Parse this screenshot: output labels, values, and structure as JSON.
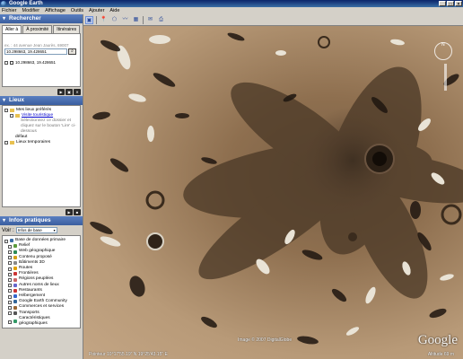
{
  "window": {
    "title": "Google Earth",
    "buttons": [
      "_",
      "□",
      "×"
    ]
  },
  "menu": [
    "Fichier",
    "Modifier",
    "Affichage",
    "Outils",
    "Ajouter",
    "Aide"
  ],
  "search": {
    "header": "Rechercher",
    "tabs": [
      "Aller à",
      "À proximité",
      "Itinéraires"
    ],
    "hint": "ex. : 44 avenue Jean Jaurès, 69007",
    "query": "10.298663, 19.428651",
    "button_icon": "magnifier-icon",
    "result": "10.298663, 19.428651"
  },
  "places": {
    "header": "Lieux",
    "items": [
      {
        "label": "Mes lieux préférés",
        "kind": "folder"
      },
      {
        "label": "Visite touristique",
        "kind": "link"
      },
      {
        "label": "Sélectionnez ce dossier et cliquez sur le bouton 'Lire' ci-dessous",
        "kind": "note"
      },
      {
        "label": "défaut",
        "kind": "plain"
      },
      {
        "label": "Lieux temporaires",
        "kind": "folder"
      }
    ]
  },
  "layers": {
    "header": "Infos pratiques",
    "view_label": "Voir :",
    "view_value": "Infos de base",
    "items": [
      {
        "label": "Base de données primaire",
        "color": "#3a6ea5"
      },
      {
        "label": "Relief",
        "color": "#5b9b3b"
      },
      {
        "label": "Web géographique",
        "color": "#2e8b57"
      },
      {
        "label": "Contenu proposé",
        "color": "#d4a017"
      },
      {
        "label": "Bâtiments 3D",
        "color": "#888888"
      },
      {
        "label": "Routes",
        "color": "#e0a000"
      },
      {
        "label": "Frontières",
        "color": "#cc3333"
      },
      {
        "label": "Régions peuplées",
        "color": "#cc6666"
      },
      {
        "label": "Autres noms de lieux",
        "color": "#6666cc"
      },
      {
        "label": "Restaurants",
        "color": "#cc3333"
      },
      {
        "label": "Hébergement",
        "color": "#3366cc"
      },
      {
        "label": "Google Earth Community",
        "color": "#336699"
      },
      {
        "label": "Commerces et services",
        "color": "#996633"
      },
      {
        "label": "Transports",
        "color": "#555555"
      },
      {
        "label": "Caractéristiques géographiques",
        "color": "#339966"
      }
    ]
  },
  "toolbar": {
    "icons": [
      "sidebar-toggle-icon",
      "placemark-icon",
      "polygon-icon",
      "path-icon",
      "overlay-icon",
      "email-icon",
      "print-icon"
    ],
    "glyphs": [
      "▣",
      "📍",
      "⬠",
      "〰",
      "▦",
      "✉",
      "⎙"
    ]
  },
  "map": {
    "copyright": "Image © 2007 DigitalGlobe",
    "logo": "Google",
    "status": "Pointeur  10°17'55.19\" N  19°25'43.15\" E",
    "eye_alt": "Altitude 69 m"
  }
}
